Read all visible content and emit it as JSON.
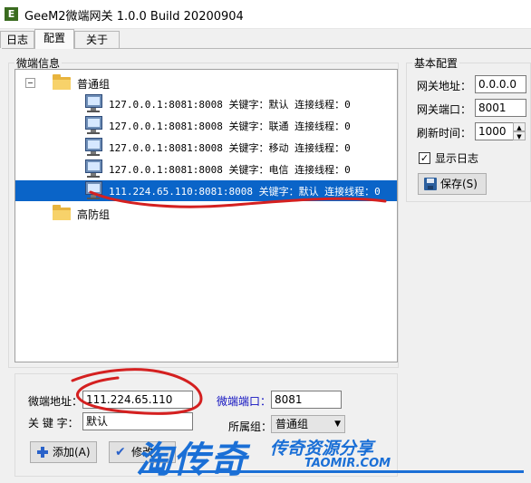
{
  "window": {
    "title": "GeeM2微端网关 1.0.0 Build 20200904",
    "icon_letter": "E"
  },
  "tabs": [
    {
      "label": "日志"
    },
    {
      "label": "配置"
    },
    {
      "label": "关于"
    }
  ],
  "micro_info": {
    "title": "微端信息",
    "tree": {
      "groups": [
        {
          "label": "普通组",
          "expanded": true,
          "entries": [
            {
              "text": "127.0.0.1:8081:8008 关键字：默认 连接线程：0",
              "selected": false
            },
            {
              "text": "127.0.0.1:8081:8008 关键字：联通 连接线程：0",
              "selected": false
            },
            {
              "text": "127.0.0.1:8081:8008 关键字：移动 连接线程：0",
              "selected": false
            },
            {
              "text": "127.0.0.1:8081:8008 关键字：电信 连接线程：0",
              "selected": false
            },
            {
              "text": "111.224.65.110:8081:8008 关键字：默认 连接线程：0",
              "selected": true
            }
          ]
        },
        {
          "label": "高防组",
          "expanded": false,
          "entries": []
        }
      ]
    }
  },
  "basic_config": {
    "title": "基本配置",
    "gateway_address_label": "网关地址：",
    "gateway_address_value": "0.0.0.0",
    "gateway_port_label": "网关端口：",
    "gateway_port_value": "8001",
    "refresh_time_label": "刷新时间：",
    "refresh_time_value": "1000",
    "show_log_label": "显示日志",
    "show_log_checked": true,
    "save_button_label": "保存(S)"
  },
  "edit_form": {
    "address_label": "微端地址：",
    "address_value": "111.224.65.110",
    "port_label": "微端端口：",
    "port_value": "8081",
    "keyword_label": "关 键 字：",
    "keyword_value": "默认",
    "group_label": "所属组：",
    "group_value": "普通组",
    "add_button_label": "添加(A)",
    "modify_button_label": "修改"
  },
  "watermark": {
    "main": "淘传奇",
    "sub": "传奇资源分享",
    "url": "TAOMIR.COM"
  },
  "colors": {
    "selection": "#0a64c8",
    "annotation": "#d42020",
    "watermark": "#1a6fd6",
    "port_label": "#1010c0"
  }
}
